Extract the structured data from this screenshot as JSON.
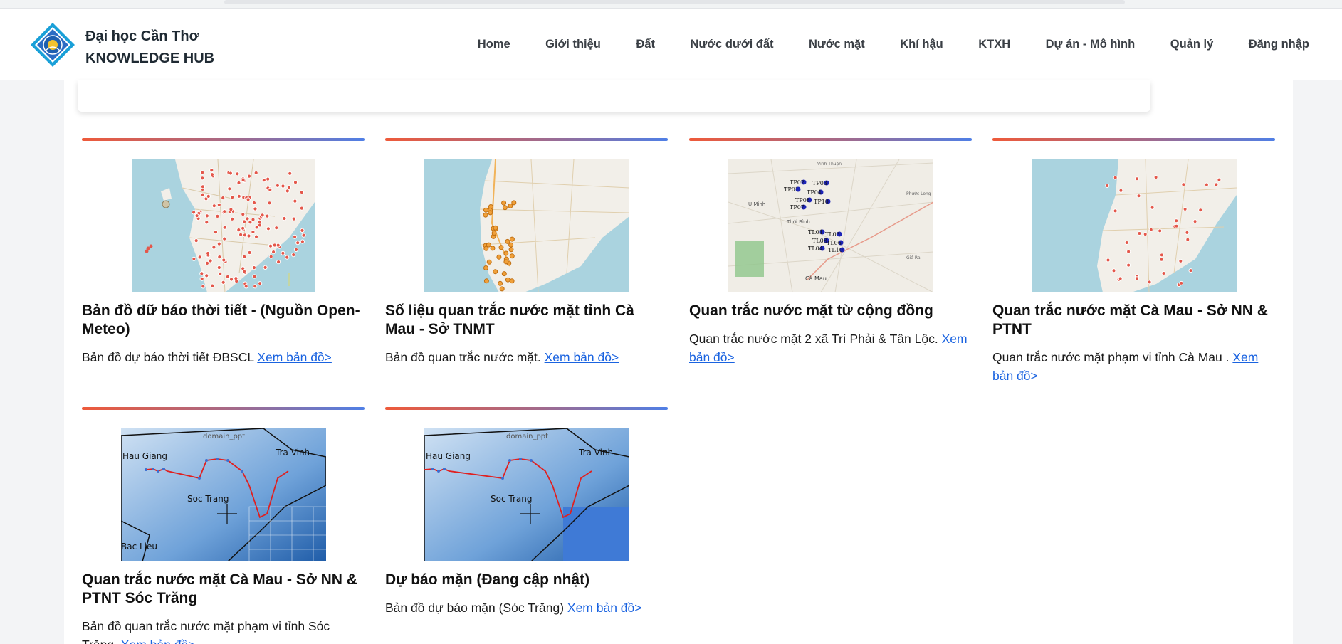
{
  "header": {
    "brand_line1": "Đại học Cần Thơ",
    "brand_line2": "KNOWLEDGE HUB",
    "nav": [
      "Home",
      "Giới thiệu",
      "Đất",
      "Nước dưới đất",
      "Nước mặt",
      "Khí hậu",
      "KTXH",
      "Dự án - Mô hình",
      "Quản lý",
      "Đăng nhập"
    ]
  },
  "cards": [
    {
      "title": "Bản đồ dữ báo thời tiết - (Nguồn Open-Meteo)",
      "desc": "Bản đồ dự báo thời tiết ĐBSCL ",
      "link": "Xem bản đồ>"
    },
    {
      "title": "Số liệu quan trắc nước mặt tỉnh Cà Mau - Sở TNMT",
      "desc": "Bản đồ quan trắc nước mặt. ",
      "link": "Xem bản đồ>"
    },
    {
      "title": "Quan trắc nước mặt từ cộng đồng",
      "desc": "Quan trắc nước mặt 2 xã Trí Phải & Tân Lộc. ",
      "link": "Xem bản đồ>",
      "map_labels": [
        "TP02",
        "TP03",
        "TP01",
        "TP04",
        "TP08",
        "TP10",
        "TP07",
        "TL01",
        "TL03",
        "TL08",
        "TL06",
        "TL04",
        "TL10"
      ],
      "place_labels": [
        "U Minh",
        "Thới Bình",
        "Cà Mau",
        "Phước Long",
        "Giá Rai",
        "Vĩnh Thuận"
      ]
    },
    {
      "title": "Quan trắc nước mặt Cà Mau - Sở NN & PTNT",
      "desc": "Quan trắc nước mặt phạm vi tỉnh Cà Mau . ",
      "link": "Xem bản đồ>"
    },
    {
      "title": "Quan trắc nước mặt Cà Mau - Sở NN & PTNT Sóc Trăng",
      "desc": "Bản đồ quan trắc nước mặt phạm vi tỉnh Sóc Trăng. ",
      "link": "Xem bản đồ>",
      "map_labels": [
        "domain_ppt",
        "Hau Giang",
        "Tra Vinh",
        "Soc Trang",
        "Bac Lieu"
      ]
    },
    {
      "title": "Dự báo mặn (Đang cập nhật)",
      "desc": "Bản đồ dự báo mặn (Sóc Trăng) ",
      "link": "Xem bản đồ>",
      "map_labels": [
        "domain_ppt",
        "Hau Giang",
        "Tra Vinh",
        "Soc Trang"
      ]
    }
  ],
  "colors": {
    "accent_start": "#ee5a3a",
    "accent_end": "#4f7fe6",
    "link": "#1a63e0",
    "sea": "#aad3df",
    "marker": "#e4574a",
    "station": "#1d24b8"
  },
  "icons": {
    "logo": "university-emblem-icon"
  }
}
